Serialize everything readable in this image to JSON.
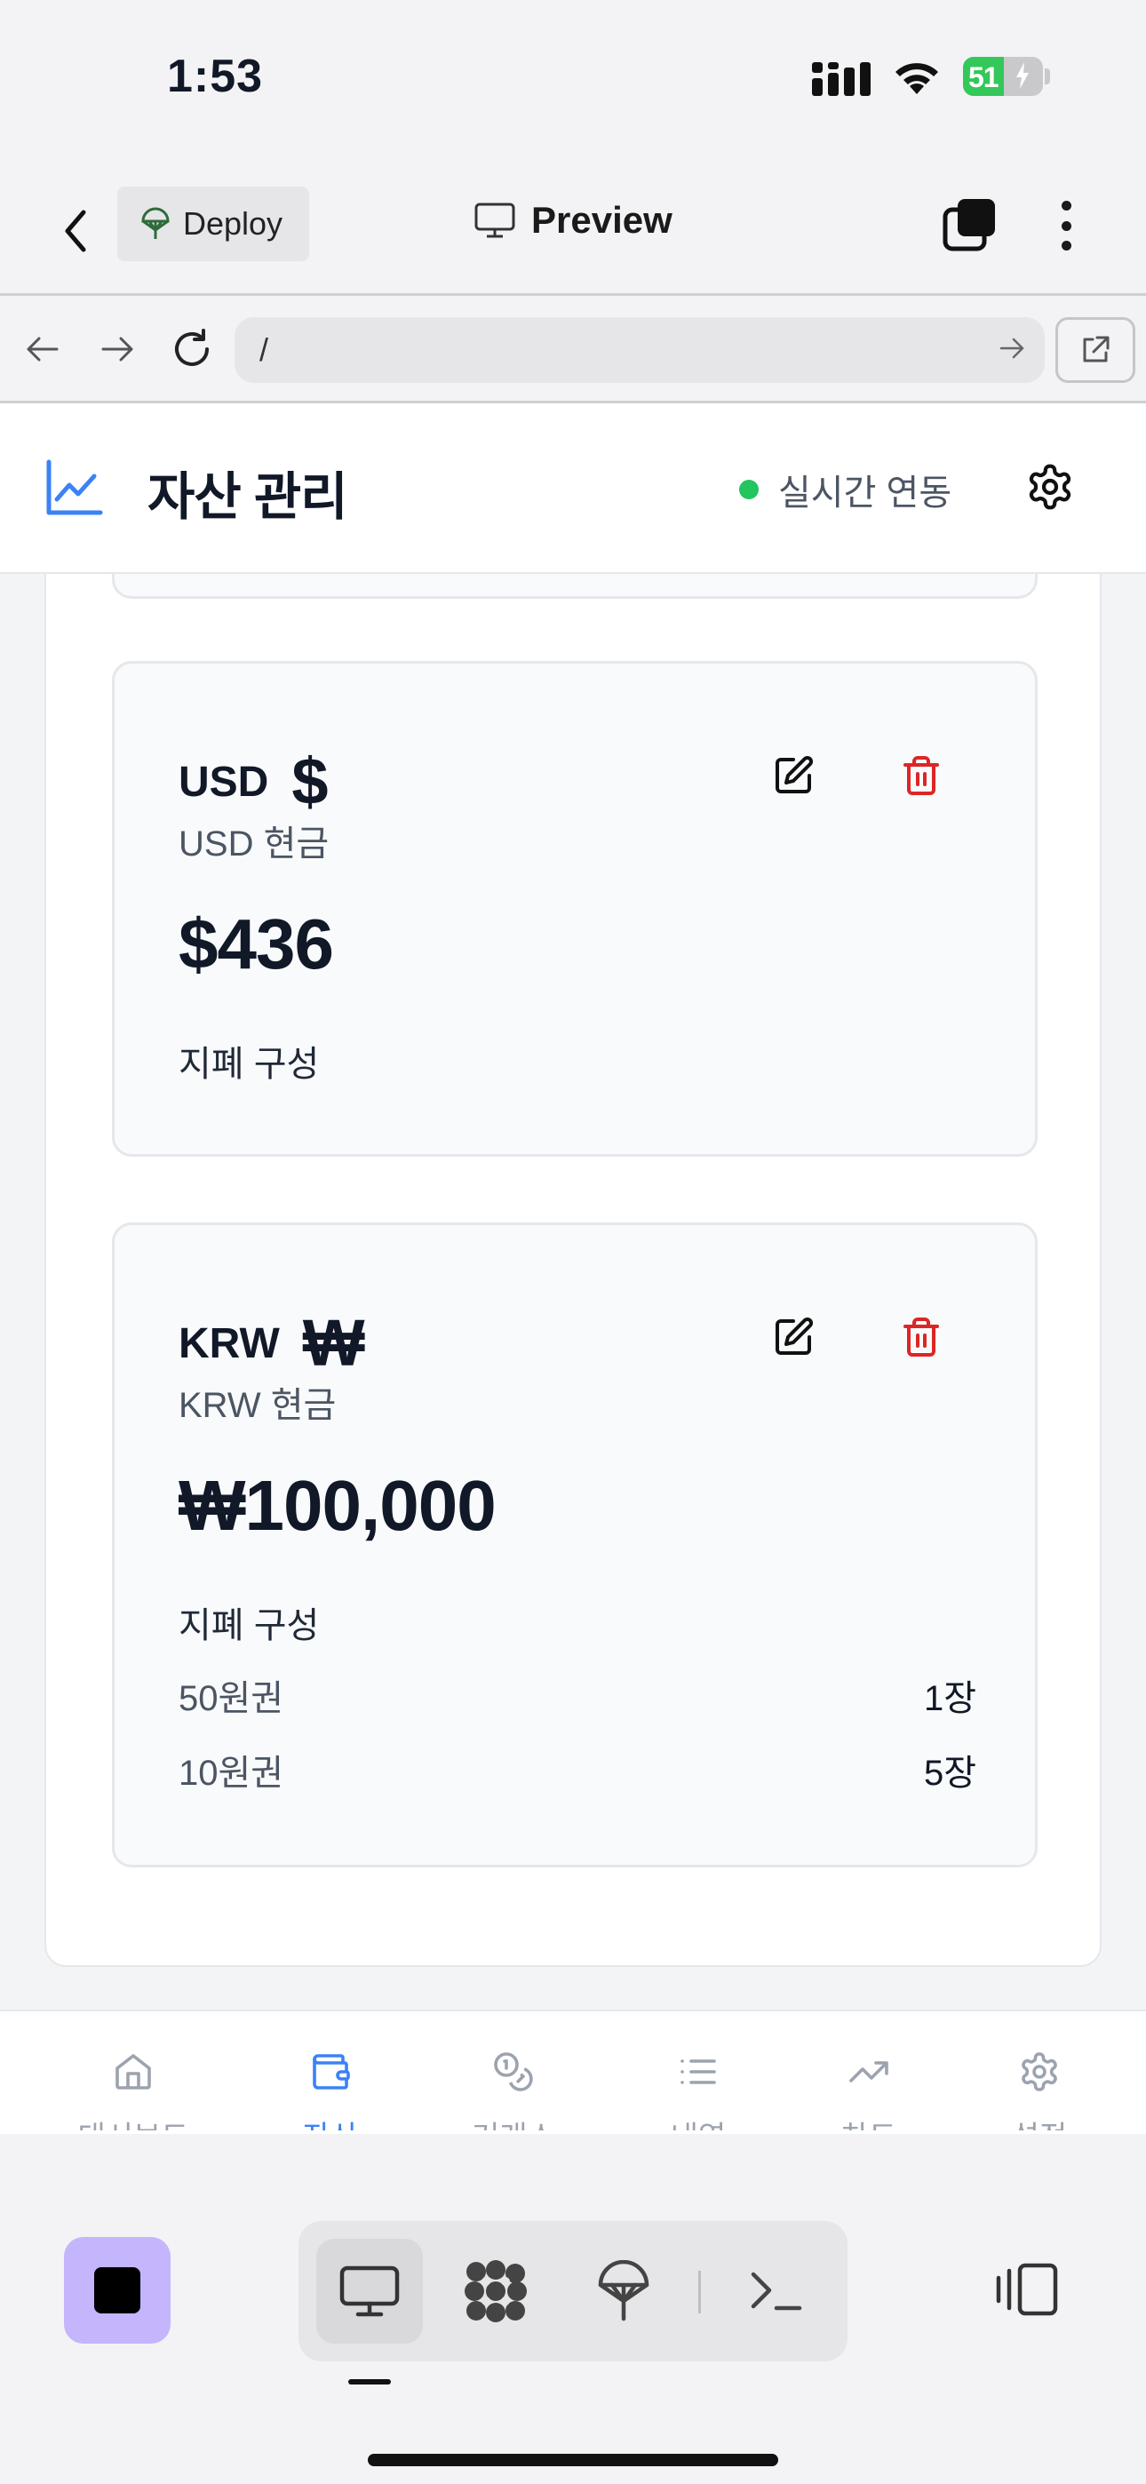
{
  "status_bar": {
    "time": "1:53",
    "battery": "51",
    "battery_level": 0.51
  },
  "app_header": {
    "deploy_label": "Deploy",
    "preview_label": "Preview"
  },
  "browser": {
    "url": "/"
  },
  "site": {
    "title": "자산 관리",
    "live_status": "실시간 연동",
    "accent_color": "#3b82f6",
    "live_color": "#22c55e",
    "delete_color": "#dc2626"
  },
  "cards": {
    "usd": {
      "code": "USD",
      "symbol": "$",
      "subtitle": "USD 현금",
      "amount": "$436",
      "section_label": "지폐 구성"
    },
    "krw": {
      "code": "KRW",
      "symbol": "₩",
      "subtitle": "KRW 현금",
      "amount": "₩100,000",
      "section_label": "지폐 구성",
      "denominations": [
        {
          "name": "50원권",
          "count": "1장"
        },
        {
          "name": "10원권",
          "count": "5장"
        }
      ]
    }
  },
  "bottom_nav": {
    "items": [
      {
        "icon": "home-icon",
        "label": "대시보드"
      },
      {
        "icon": "wallet-icon",
        "label": "자산",
        "active": true
      },
      {
        "icon": "coins-icon",
        "label": "거래소"
      },
      {
        "icon": "list-icon",
        "label": "내역"
      },
      {
        "icon": "trending-up-icon",
        "label": "차트"
      },
      {
        "icon": "gear-icon",
        "label": "설정"
      }
    ]
  }
}
